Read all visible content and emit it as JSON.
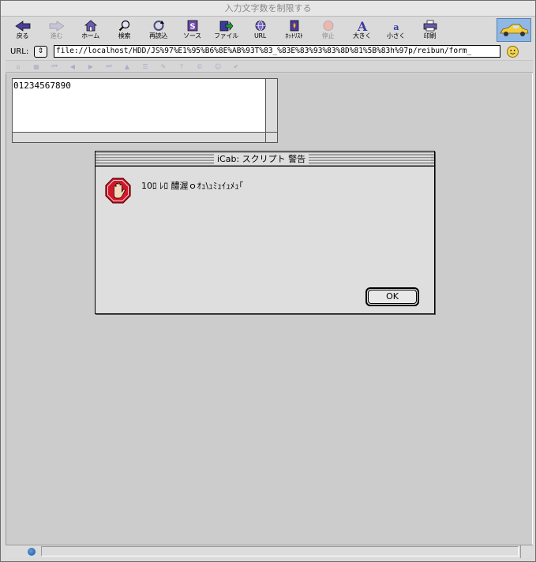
{
  "window": {
    "title": "入力文字数を制限する"
  },
  "toolbar": {
    "buttons": [
      {
        "label": "戻る",
        "icon": "back-arrow-icon",
        "enabled": true
      },
      {
        "label": "進む",
        "icon": "forward-arrow-icon",
        "enabled": false
      },
      {
        "label": "ホーム",
        "icon": "home-icon",
        "enabled": true
      },
      {
        "label": "検索",
        "icon": "magnifier-icon",
        "enabled": true
      },
      {
        "label": "再読込",
        "icon": "reload-icon",
        "enabled": true
      },
      {
        "label": "ソース",
        "icon": "source-icon",
        "enabled": true
      },
      {
        "label": "ファイル",
        "icon": "file-icon",
        "enabled": true
      },
      {
        "label": "URL",
        "icon": "globe-icon",
        "enabled": true
      },
      {
        "label": "ﾎｯﾄﾘｽﾄ",
        "icon": "hotlist-icon",
        "enabled": true
      },
      {
        "label": "停止",
        "icon": "stop-sign-icon",
        "enabled": false
      },
      {
        "label": "大きく",
        "icon": "font-larger-icon",
        "enabled": true
      },
      {
        "label": "小さく",
        "icon": "font-smaller-icon",
        "enabled": true
      },
      {
        "label": "印刷",
        "icon": "printer-icon",
        "enabled": true
      }
    ]
  },
  "urlbar": {
    "label": "URL:",
    "value": "file://localhost/HDD/JS%97%E1%95%B6%8E%AB%93T%83_%83E%83%93%83%8D%81%5B%83h%97p/reibun/form_"
  },
  "page": {
    "textarea_value": "01234567890"
  },
  "dialog": {
    "title": "iCab: スクリプト 警告",
    "message": "10ﾛ ﾚﾛ 醴渥ｏｵｭ\\ｭﾐｭｲｭﾒｭ｢",
    "ok_label": "OK"
  },
  "colors": {
    "stop_red": "#d2192b",
    "logo_blue": "#8fb8e6"
  }
}
